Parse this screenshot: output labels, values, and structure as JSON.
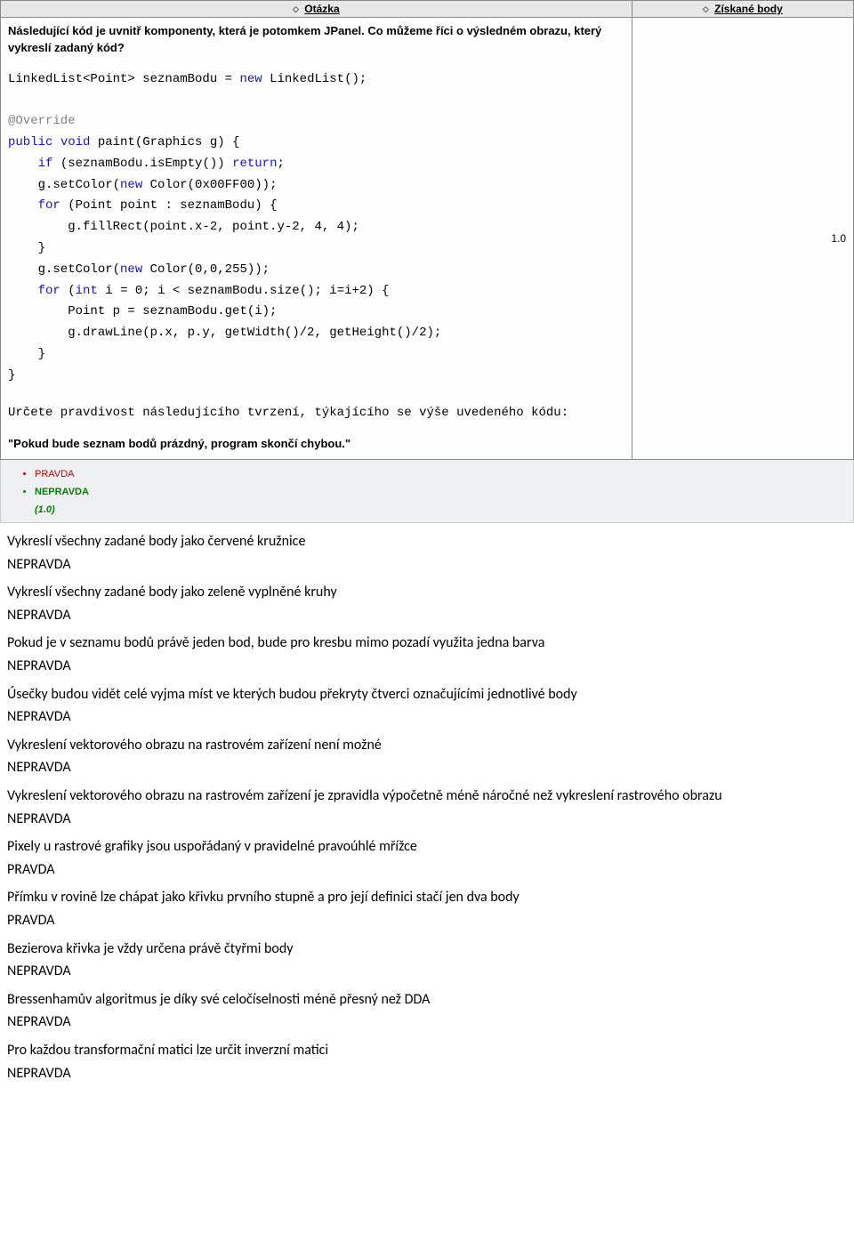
{
  "headers": {
    "question": "Otázka",
    "score": "Získané body"
  },
  "question": {
    "title": "Následující kód je uvnitř komponenty, která je potomkem JPanel. Co můžeme říci o výsledném obrazu, který vykreslí zadaný kód?",
    "code": {
      "l1a": "LinkedList<Point> seznamBodu = ",
      "l1b": "new",
      "l1c": " LinkedList();",
      "l2": "",
      "l3": "@Override",
      "l4a": "public",
      "l4b": " ",
      "l4c": "void",
      "l4d": " paint(Graphics g) {",
      "l5a": "    ",
      "l5b": "if",
      "l5c": " (seznamBodu.isEmpty()) ",
      "l5d": "return",
      "l5e": ";",
      "l6a": "    g.setColor(",
      "l6b": "new",
      "l6c": " Color(0x00FF00));",
      "l7a": "    ",
      "l7b": "for",
      "l7c": " (Point point : seznamBodu) {",
      "l8": "        g.fillRect(point.x-2, point.y-2, 4, 4);",
      "l9": "    }",
      "l10a": "    g.setColor(",
      "l10b": "new",
      "l10c": " Color(0,0,255));",
      "l11a": "    ",
      "l11b": "for",
      "l11c": " (",
      "l11d": "int",
      "l11e": " i = 0; i < seznamBodu.size(); i=i+2) {",
      "l12": "        Point p = seznamBodu.get(i);",
      "l13": "        g.drawLine(p.x, p.y, getWidth()/2, getHeight()/2);",
      "l14": "    }",
      "l15": "}"
    },
    "instruction": "Určete pravdivost následujícího tvrzení, týkajícího se výše uvedeného kódu:",
    "statement": "\"Pokud bude seznam bodů prázdný, program skončí chybou.\"",
    "choice_false": "PRAVDA",
    "choice_true": "NEPRAVDA",
    "score_line": "(1.0)",
    "score": "1.0"
  },
  "doc_items": [
    {
      "stmt": "Vykreslí všechny zadané body jako červené kružnice",
      "ans": "NEPRAVDA"
    },
    {
      "stmt": "Vykreslí všechny zadané body jako zeleně vyplněné kruhy",
      "ans": "NEPRAVDA"
    },
    {
      "stmt": "Pokud je v seznamu bodů právě jeden bod, bude pro kresbu mimo pozadí využita jedna barva",
      "ans": "NEPRAVDA"
    },
    {
      "stmt": "Úsečky budou vidět celé vyjma míst ve kterých budou překryty čtverci označujícími jednotlivé body",
      "ans": "NEPRAVDA"
    },
    {
      "stmt": "Vykreslení vektorového obrazu na rastrovém zařízení není možné",
      "ans": "NEPRAVDA"
    },
    {
      "stmt": "Vykreslení vektorového obrazu na rastrovém zařízení je zpravidla výpočetně méně náročné než vykreslení rastrového obrazu",
      "ans": "NEPRAVDA"
    },
    {
      "stmt": "Pixely u rastrové grafiky jsou uspořádaný v pravidelné pravoúhlé mřížce",
      "ans": "PRAVDA"
    },
    {
      "stmt": "Přímku v rovině lze chápat jako křivku prvního stupně a pro její definici stačí jen dva body",
      "ans": "PRAVDA"
    },
    {
      "stmt": "Bezierova křivka je vždy určena právě čtyřmi body",
      "ans": "NEPRAVDA"
    },
    {
      "stmt": "Bressenhamův algoritmus je díky své celočíselnosti méně přesný než DDA",
      "ans": "NEPRAVDA"
    },
    {
      "stmt": "Pro každou transformační matici lze určit inverzní matici",
      "ans": "NEPRAVDA"
    }
  ]
}
